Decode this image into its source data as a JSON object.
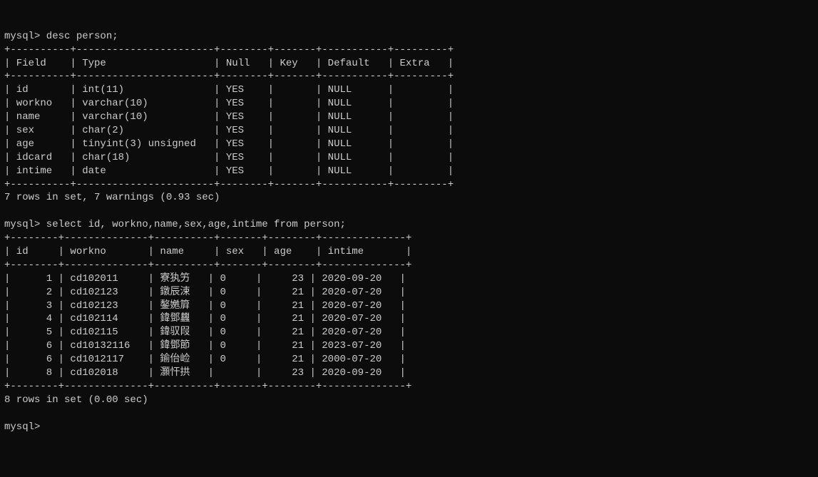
{
  "prompt": "mysql>",
  "cmd1": "desc person;",
  "desc": {
    "headers": [
      "Field",
      "Type",
      "Null",
      "Key",
      "Default",
      "Extra"
    ],
    "rows": [
      {
        "field": "id",
        "type": "int(11)",
        "null": "YES",
        "key": "",
        "default": "NULL",
        "extra": ""
      },
      {
        "field": "workno",
        "type": "varchar(10)",
        "null": "YES",
        "key": "",
        "default": "NULL",
        "extra": ""
      },
      {
        "field": "name",
        "type": "varchar(10)",
        "null": "YES",
        "key": "",
        "default": "NULL",
        "extra": ""
      },
      {
        "field": "sex",
        "type": "char(2)",
        "null": "YES",
        "key": "",
        "default": "NULL",
        "extra": ""
      },
      {
        "field": "age",
        "type": "tinyint(3) unsigned",
        "null": "YES",
        "key": "",
        "default": "NULL",
        "extra": ""
      },
      {
        "field": "idcard",
        "type": "char(18)",
        "null": "YES",
        "key": "",
        "default": "NULL",
        "extra": ""
      },
      {
        "field": "intime",
        "type": "date",
        "null": "YES",
        "key": "",
        "default": "NULL",
        "extra": ""
      }
    ],
    "status": "7 rows in set, 7 warnings (0.93 sec)"
  },
  "cmd2": "select id, workno,name,sex,age,intime from person;",
  "select": {
    "headers": [
      "id",
      "workno",
      "name",
      "sex",
      "age",
      "intime"
    ],
    "rows": [
      {
        "id": 1,
        "workno": "cd102011",
        "name": "寮犱竻",
        "sex": "0",
        "age": 23,
        "intime": "2020-09-20"
      },
      {
        "id": 2,
        "workno": "cd102123",
        "name": "鐓辰涑",
        "sex": "0",
        "age": 21,
        "intime": "2020-07-20"
      },
      {
        "id": 3,
        "workno": "cd102123",
        "name": "鏊嬎簈",
        "sex": "0",
        "age": 21,
        "intime": "2020-07-20"
      },
      {
        "id": 4,
        "workno": "cd102114",
        "name": "鍏鄧蠿",
        "sex": "0",
        "age": 21,
        "intime": "2020-07-20"
      },
      {
        "id": 5,
        "workno": "cd102115",
        "name": "鍏驭叚",
        "sex": "0",
        "age": 21,
        "intime": "2020-07-20"
      },
      {
        "id": 6,
        "workno": "cd10132116",
        "name": "鍏鄧節",
        "sex": "0",
        "age": 21,
        "intime": "2023-07-20"
      },
      {
        "id": 6,
        "workno": "cd1012117",
        "name": "鍮佁崄",
        "sex": "0",
        "age": 21,
        "intime": "2000-07-20"
      },
      {
        "id": 8,
        "workno": "cd102018",
        "name": "灝忓拱",
        "sex": "",
        "age": 23,
        "intime": "2020-09-20"
      }
    ],
    "status": "8 rows in set (0.00 sec)"
  }
}
